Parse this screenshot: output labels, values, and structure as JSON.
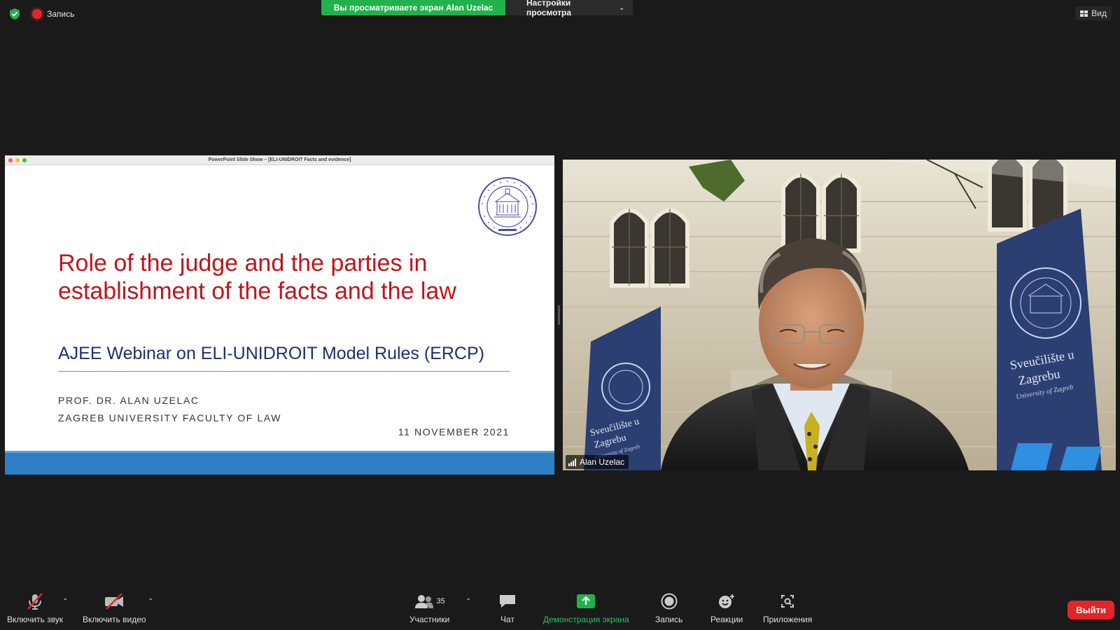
{
  "topbar": {
    "recording_label": "Запись",
    "share_banner": "Вы просматриваете экран Alan Uzelac",
    "view_options": "Настройки просмотра",
    "view_button": "Вид"
  },
  "slide_window": {
    "title": "PowerPoint Slide Show – [ELI-UNIDROIT Facts and evidence]",
    "slide": {
      "title": "Role of the judge and the parties in establishment of the facts and the law",
      "subtitle": "AJEE Webinar on ELI-UNIDROIT Model Rules (ERCP)",
      "author_line1": "PROF. DR. ALAN UZELAC",
      "author_line2": "ZAGREB UNIVERSITY FACULTY OF LAW",
      "date": "11 NOVEMBER 2021"
    }
  },
  "video": {
    "participant_name": "Alan Uzelac",
    "banner_left_line1": "Sveučilište u",
    "banner_left_line2": "Zagrebu",
    "banner_left_line3": "University of Zagreb",
    "banner_right_line1": "Sveučilište u",
    "banner_right_line2": "Zagrebu",
    "banner_right_line3": "University of Zagreb"
  },
  "toolbar": {
    "mute_label": "Включить звук",
    "video_label": "Включить видео",
    "participants_label": "Участники",
    "participants_count": "35",
    "chat_label": "Чат",
    "share_label": "Демонстрация экрана",
    "record_label": "Запись",
    "reactions_label": "Реакции",
    "apps_label": "Приложения",
    "leave_label": "Выйти"
  },
  "colors": {
    "share_green": "#22b14c",
    "leave_red": "#e0262a",
    "slide_title_red": "#c0141c",
    "slide_subtitle_blue": "#1e2f6e",
    "slide_footer_blue": "#2f7fc4"
  }
}
